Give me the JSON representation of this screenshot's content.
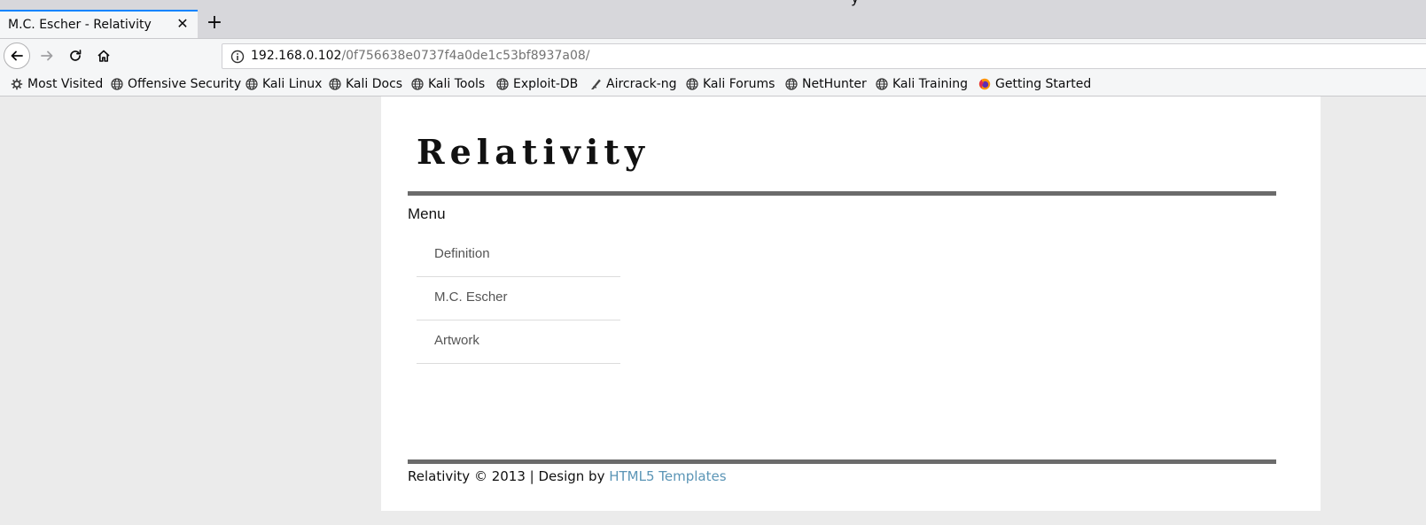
{
  "browser": {
    "tab_title": "M.C. Escher - Relativity",
    "close_glyph": "✕",
    "new_tab_glyph": "+",
    "title_fragment": "y",
    "url_host": "192.168.0.102",
    "url_path": "/0f756638e0737f4a0de1c53bf8937a08/"
  },
  "bookmarks": [
    {
      "label": "Most Visited",
      "icon": "gear-icon"
    },
    {
      "label": "Offensive Security",
      "icon": "globe-icon"
    },
    {
      "label": "Kali Linux",
      "icon": "globe-icon"
    },
    {
      "label": "Kali Docs",
      "icon": "globe-icon"
    },
    {
      "label": "Kali Tools",
      "icon": "globe-icon"
    },
    {
      "label": "Exploit-DB",
      "icon": "globe-icon"
    },
    {
      "label": "Aircrack-ng",
      "icon": "aircrack-icon"
    },
    {
      "label": "Kali Forums",
      "icon": "globe-icon"
    },
    {
      "label": "NetHunter",
      "icon": "globe-icon"
    },
    {
      "label": "Kali Training",
      "icon": "globe-icon"
    },
    {
      "label": "Getting Started",
      "icon": "firefox-icon"
    }
  ],
  "site": {
    "logo": "Relativity",
    "menu_heading": "Menu",
    "menu": [
      {
        "label": "Definition"
      },
      {
        "label": "M.C. Escher"
      },
      {
        "label": "Artwork"
      }
    ],
    "footer_text": "Relativity © 2013 | Design by ",
    "footer_link": "HTML5 Templates"
  },
  "colors": {
    "tab_accent": "#0a84ff",
    "link": "#5b95b6",
    "rule": "#6b6b6b"
  }
}
